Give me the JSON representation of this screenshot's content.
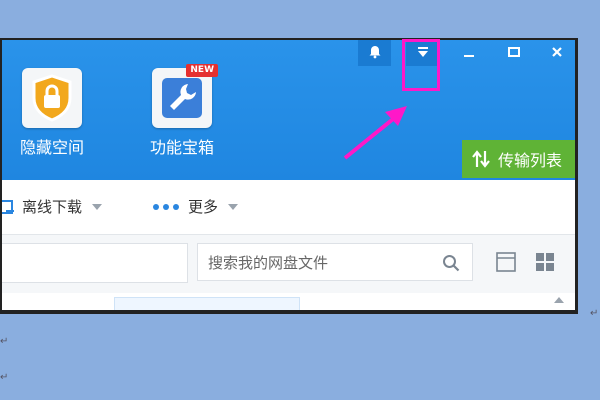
{
  "window_controls": {
    "bell": "bell-icon",
    "dropdown": "caret-down-icon",
    "minimize": "minimize-icon",
    "maximize": "maximize-icon",
    "close": "close-icon"
  },
  "features": [
    {
      "label": "隐藏空间",
      "icon": "lock-shield-icon"
    },
    {
      "label": "功能宝箱",
      "icon": "wrench-icon",
      "badge": "NEW"
    }
  ],
  "transfer_button": {
    "label": "传输列表",
    "icon": "transfer-arrows-icon"
  },
  "toolbar": {
    "offline_download": "离线下载",
    "more": "更多"
  },
  "search": {
    "placeholder": "搜索我的网盘文件",
    "icon": "search-icon"
  },
  "view_controls": [
    "list-view-icon",
    "grid-view-icon"
  ],
  "colors": {
    "header_blue": "#1f86e0",
    "transfer_green": "#5fb336",
    "annotation_magenta": "#ff18c8",
    "badge_red": "#e53030",
    "lock_yellow": "#f2a81d",
    "wrench_blue": "#3b7fd9"
  }
}
